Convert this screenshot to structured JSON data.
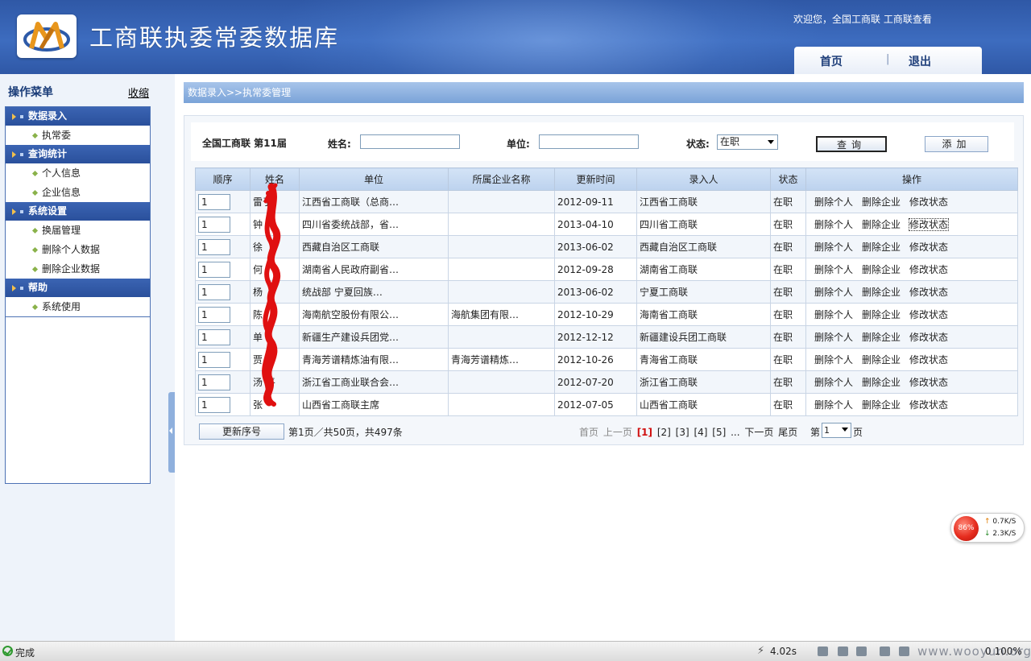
{
  "header": {
    "site_title": "工商联执委常委数据库",
    "welcome": "欢迎您，全国工商联  工商联查看",
    "nav": {
      "home": "首页",
      "sep": "|",
      "logout": "退出"
    }
  },
  "sidebar": {
    "title": "操作菜单",
    "collapse": "收缩",
    "groups": [
      {
        "label": "数据录入",
        "items": [
          "执常委"
        ]
      },
      {
        "label": "查询统计",
        "items": [
          "个人信息",
          "企业信息"
        ]
      },
      {
        "label": "系统设置",
        "items": [
          "换届管理",
          "删除个人数据",
          "删除企业数据"
        ]
      },
      {
        "label": "帮助",
        "items": [
          "系统使用"
        ]
      }
    ]
  },
  "breadcrumb": "数据录入>>执常委管理",
  "search": {
    "org": "全国工商联  第11届",
    "name_label": "姓名:",
    "unit_label": "单位:",
    "status_label": "状态:",
    "status_value": "在职",
    "query_button": "查询",
    "add_button": "添加"
  },
  "table": {
    "columns": [
      "顺序",
      "姓名",
      "单位",
      "所属企业名称",
      "更新时间",
      "录入人",
      "状态",
      "操作"
    ],
    "actions": [
      "删除个人",
      "删除企业",
      "修改状态"
    ],
    "rows": [
      {
        "order": "1",
        "name": "雷于",
        "unit": "江西省工商联（总商…",
        "company": "",
        "updated": "2012-09-11",
        "entered_by": "江西省工商联",
        "status": "在职"
      },
      {
        "order": "1",
        "name": "钟",
        "unit": "四川省委统战部，省…",
        "company": "",
        "updated": "2013-04-10",
        "entered_by": "四川省工商联",
        "status": "在职"
      },
      {
        "order": "1",
        "name": "徐",
        "unit": "西藏自治区工商联",
        "company": "",
        "updated": "2013-06-02",
        "entered_by": "西藏自治区工商联",
        "status": "在职"
      },
      {
        "order": "1",
        "name": "何",
        "unit": "湖南省人民政府副省…",
        "company": "",
        "updated": "2012-09-28",
        "entered_by": "湖南省工商联",
        "status": "在职"
      },
      {
        "order": "1",
        "name": "杨",
        "unit": "统战部 宁夏回族…",
        "company": "",
        "updated": "2013-06-02",
        "entered_by": "宁夏工商联",
        "status": "在职"
      },
      {
        "order": "1",
        "name": "陈",
        "unit": "海南航空股份有限公…",
        "company": "海航集团有限…",
        "updated": "2012-10-29",
        "entered_by": "海南省工商联",
        "status": "在职"
      },
      {
        "order": "1",
        "name": "单",
        "unit": "新疆生产建设兵团党…",
        "company": "",
        "updated": "2012-12-12",
        "entered_by": "新疆建设兵团工商联",
        "status": "在职"
      },
      {
        "order": "1",
        "name": "贾 芳",
        "unit": "青海芳谱精炼油有限…",
        "company": "青海芳谱精炼…",
        "updated": "2012-10-26",
        "entered_by": "青海省工商联",
        "status": "在职"
      },
      {
        "order": "1",
        "name": "汤 平",
        "unit": "浙江省工商业联合会…",
        "company": "",
        "updated": "2012-07-20",
        "entered_by": "浙江省工商联",
        "status": "在职"
      },
      {
        "order": "1",
        "name": "张",
        "unit": "山西省工商联主席",
        "company": "",
        "updated": "2012-07-05",
        "entered_by": "山西省工商联",
        "status": "在职"
      }
    ]
  },
  "pager": {
    "reorder_button": "更新序号",
    "info": "第1页／共50页，共497条",
    "first": "首页",
    "prev": "上一页",
    "current": "[1]",
    "pages": "[2] [3] [4] [5] ...",
    "next": "下一页",
    "last": "尾页",
    "goto_prefix": "第",
    "goto_value": "1",
    "goto_suffix": "页"
  },
  "speed_widget": {
    "percent": "86%",
    "up": "0.7K/S",
    "down": "2.3K/S"
  },
  "statusbar": {
    "status": "完成",
    "load_time": "4.02s",
    "zoom": "0  100%"
  },
  "watermark": "www.wooyun.org",
  "colors": {
    "header_blue": "#2f58a6",
    "menu_blue": "#2a509c",
    "page_current": "#d01010",
    "annotation_red": "#e01010"
  }
}
